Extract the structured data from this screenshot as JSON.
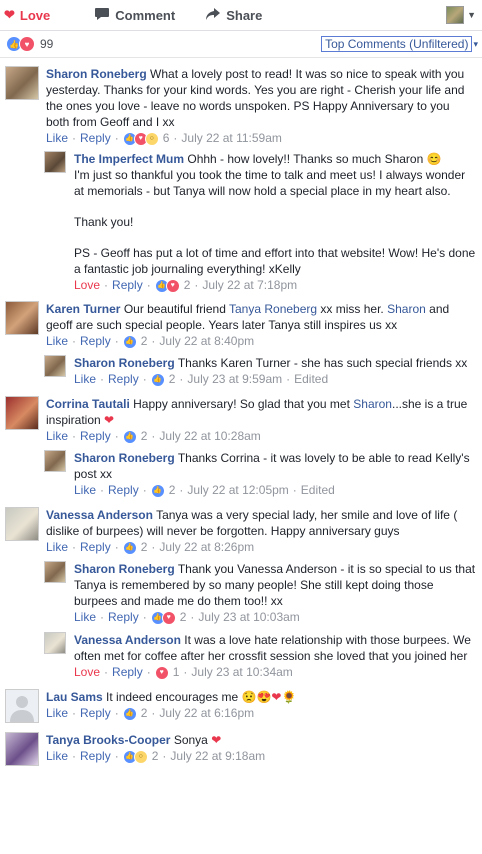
{
  "actions": {
    "love": "Love",
    "comment": "Comment",
    "share": "Share"
  },
  "reactions": {
    "count": "99",
    "sort_label": "Top Comments (Unfiltered)"
  },
  "comments": [
    {
      "name": "Sharon Roneberg",
      "text": "What a lovely post to read! It was so nice to speak with you yesterday. Thanks for your kind words. Yes you are right - Cherish your life and the ones you love - leave no words unspoken. PS Happy Anniversary to you both from Geoff and I xx",
      "like": "Like",
      "reply": "Reply",
      "count": "6",
      "time": "July 22 at 11:59am",
      "replies": [
        {
          "name": "The Imperfect Mum",
          "text": "Ohhh - how lovely!! Thanks so much Sharon",
          "text2": "I'm just so thankful you took the time to talk and meet us! I always wonder at memorials - but Tanya will now hold a special place in my heart also.",
          "text3": "Thank you!",
          "text4": "PS - Geoff has put a lot of time and effort into that website! Wow! He's done a fantastic job journaling everything! xKelly",
          "like": "Love",
          "reply": "Reply",
          "count": "2",
          "time": "July 22 at 7:18pm"
        }
      ]
    },
    {
      "name": "Karen Turner",
      "text_a": "Our beautiful friend",
      "link1": "Tanya Roneberg",
      "text_b": "xx miss her.",
      "link2": "Sharon",
      "text_c": "and geoff are such special people. Years later Tanya still inspires us xx",
      "like": "Like",
      "reply": "Reply",
      "count": "2",
      "time": "July 22 at 8:40pm",
      "replies": [
        {
          "name": "Sharon Roneberg",
          "text": "Thanks Karen Turner - she has such special friends xx",
          "like": "Like",
          "reply": "Reply",
          "count": "2",
          "time": "July 23 at 9:59am",
          "edited": "Edited"
        }
      ]
    },
    {
      "name": "Corrina Tautali",
      "text_a": "Happy anniversary! So glad that you met",
      "link1": "Sharon",
      "text_b": "...she is a true inspiration",
      "like": "Like",
      "reply": "Reply",
      "count": "2",
      "time": "July 22 at 10:28am",
      "replies": [
        {
          "name": "Sharon Roneberg",
          "text": "Thanks Corrina - it was lovely to be able to read Kelly's post xx",
          "like": "Like",
          "reply": "Reply",
          "count": "2",
          "time": "July 22 at 12:05pm",
          "edited": "Edited"
        }
      ]
    },
    {
      "name": "Vanessa Anderson",
      "text": "Tanya was a very special lady, her smile and love of life ( dislike of burpees) will never be forgotten. Happy anniversary guys",
      "like": "Like",
      "reply": "Reply",
      "count": "2",
      "time": "July 22 at 8:26pm",
      "replies": [
        {
          "name": "Sharon Roneberg",
          "text": "Thank you Vanessa Anderson - it is so special to us that Tanya is remembered by so many people! She still kept doing those burpees and made me do them too!! xx",
          "like": "Like",
          "reply": "Reply",
          "count": "2",
          "time": "July 23 at 10:03am"
        },
        {
          "name": "Vanessa Anderson",
          "text": "It was a love hate relationship with those burpees. We often met for coffee after her crossfit session she loved that you joined her",
          "like": "Love",
          "reply": "Reply",
          "count": "1",
          "time": "July 23 at 10:34am"
        }
      ]
    },
    {
      "name": "Lau Sams",
      "text": "It indeed encourages me",
      "like": "Like",
      "reply": "Reply",
      "count": "2",
      "time": "July 22 at 6:16pm"
    },
    {
      "name": "Tanya Brooks-Cooper",
      "text": "Sonya",
      "like": "Like",
      "reply": "Reply",
      "count": "2",
      "time": "July 22 at 9:18am"
    }
  ]
}
